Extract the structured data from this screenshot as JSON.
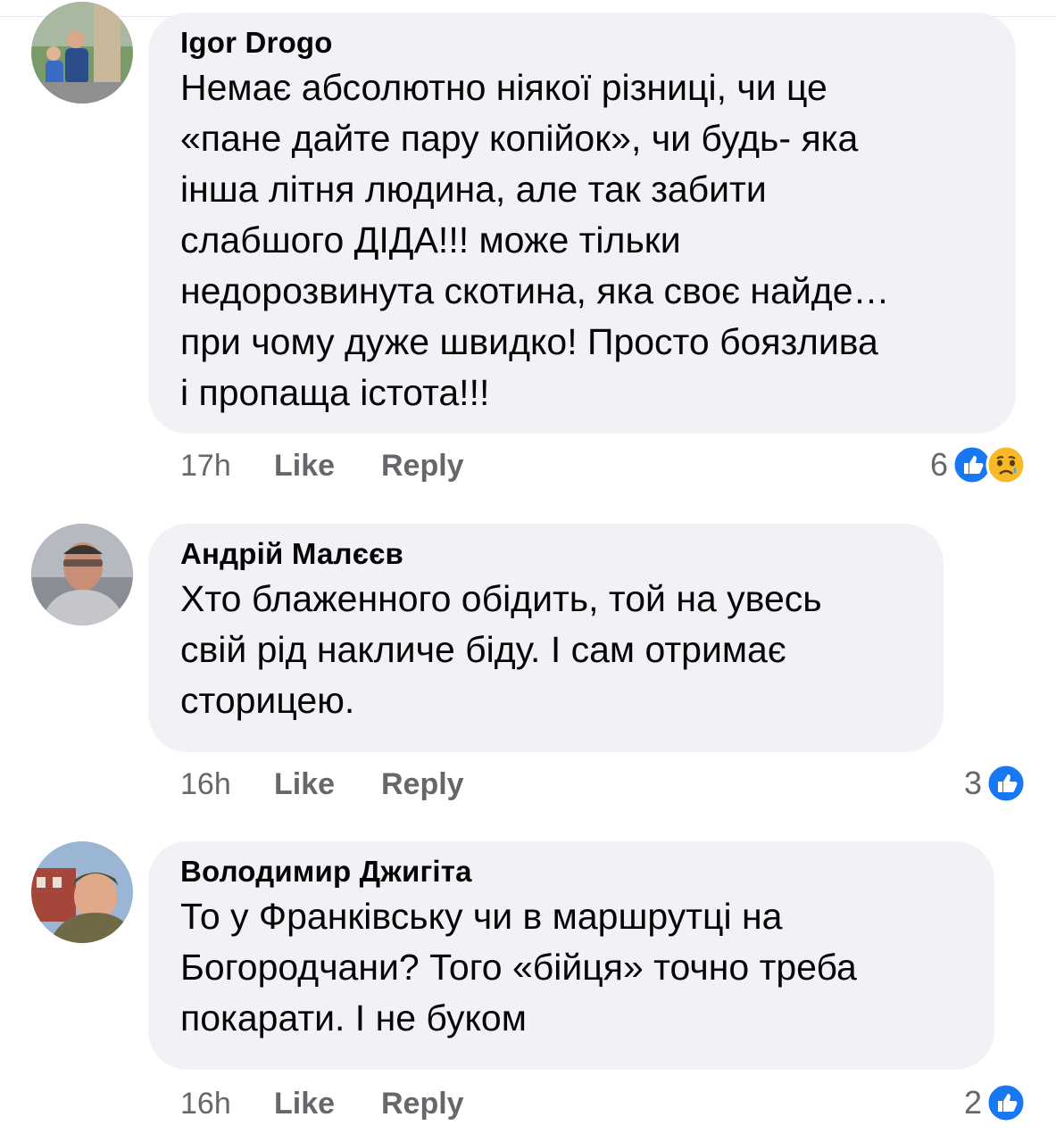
{
  "comments": [
    {
      "author": "Igor Drogo",
      "lines": [
        "Немає абсолютно ніякої різниці, чи це",
        "«пане дайте пару копійок», чи будь- яка",
        "інша літня людина, але так забити",
        "слабшого ДІДА!!! може тільки",
        "недорозвинута скотина, яка своє найде…",
        "при чому дуже швидко! Просто боязлива",
        "і пропаща істота!!!"
      ],
      "time": "17h",
      "like_label": "Like",
      "reply_label": "Reply",
      "reaction_count": "6",
      "reactions": [
        "like-icon",
        "sad-icon"
      ]
    },
    {
      "author": "Андрій Малєєв",
      "lines": [
        "Хто блаженного обідить, той на увесь",
        "свій рід накличе біду. І сам отримає",
        "сторицею."
      ],
      "time": "16h",
      "like_label": "Like",
      "reply_label": "Reply",
      "reaction_count": "3",
      "reactions": [
        "like-icon"
      ]
    },
    {
      "author": "Володимир Джигіта",
      "lines": [
        "То у Франківську чи в маршрутці на",
        "Богородчани? Того «бійця» точно треба",
        "покарати. І не буком"
      ],
      "time": "16h",
      "like_label": "Like",
      "reply_label": "Reply",
      "reaction_count": "2",
      "reactions": [
        "like-icon"
      ]
    }
  ],
  "colors": {
    "bubble": "#f0f2f5",
    "meta_text": "#65676b",
    "like_blue": "#1877f2",
    "sad_yellow": "#f7b928"
  }
}
